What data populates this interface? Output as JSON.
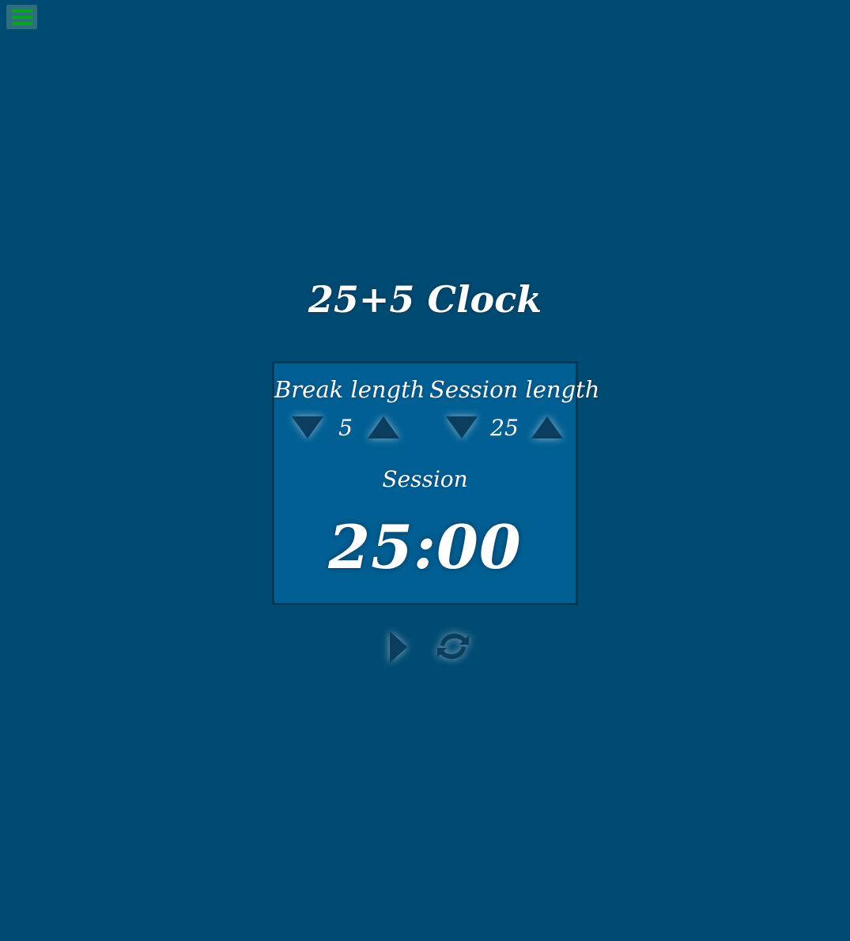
{
  "title": "25+5 Clock",
  "break": {
    "label": "Break length",
    "value": "5",
    "decrement_icon": "triangle-down-icon",
    "increment_icon": "triangle-up-icon"
  },
  "session": {
    "label": "Session length",
    "value": "25",
    "decrement_icon": "triangle-down-icon",
    "increment_icon": "triangle-up-icon"
  },
  "timer": {
    "label": "Session",
    "time_left": "25:00"
  },
  "controls": {
    "start_stop_icon": "play-icon",
    "reset_icon": "refresh-icon"
  },
  "menu": {
    "icon": "hamburger-menu-icon"
  },
  "colors": {
    "background": "#004b73",
    "panel": "#025f94",
    "panel_border": "#013a59",
    "icon_fill": "#0b3d5e",
    "menu_button_bg": "#2e6f7f",
    "menu_bars": "#0aa41e",
    "text": "#ffffff"
  }
}
